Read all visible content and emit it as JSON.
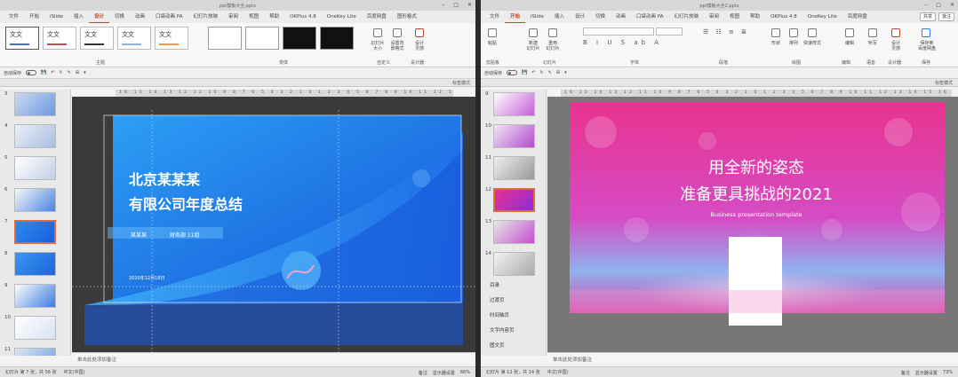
{
  "left": {
    "title": "ppt模板大全.pptx",
    "tabs": [
      "文件",
      "开始",
      "iSlide",
      "插入",
      "设计",
      "切换",
      "动画",
      "口袋动画 PA",
      "幻灯片放映",
      "审阅",
      "视图",
      "帮助",
      "OKPlus 4.8",
      "OneKey Lite",
      "百度网盘",
      "图形格式"
    ],
    "active_tab": "设计",
    "groups": {
      "theme": "主题",
      "variant": "变体",
      "customize": "自定义",
      "designer": "设计器"
    },
    "theme_text": "文文",
    "buttons": {
      "slide_size": "幻灯片\n大小",
      "bg_format": "设置背\n景格式",
      "design_ideas": "设计\n灵感"
    },
    "autosave": "自动保存",
    "label_mode": "标签模式",
    "ruler_marks": "16 15 14 13 12 11 10 9 8 7 6 5 4 3 2 1 0 1 2 3 4 5 6 7 8 9 10 11 12 13 14 15 16",
    "thumb_numbers": [
      "3",
      "4",
      "5",
      "6",
      "7",
      "8",
      "9",
      "10",
      "11"
    ],
    "selected_thumb": "7",
    "slide": {
      "title1": "北京某某某",
      "title2": "有限公司年度总结",
      "reporter": "某某某",
      "dept": "财务部 11组",
      "date": "2020年12月18日"
    },
    "notes": "单击此处添加备注",
    "status": {
      "slide": "幻灯片 第 7 张，共 56 张",
      "lang": "中文(中国)",
      "notes": "备注",
      "display": "显示器设置",
      "zoom": "66%"
    }
  },
  "right": {
    "title": "ppt模板大全2.pptx",
    "tabs": [
      "文件",
      "开始",
      "iSlide",
      "插入",
      "设计",
      "切换",
      "动画",
      "口袋动画 PA",
      "幻灯片放映",
      "审阅",
      "视图",
      "帮助",
      "OKPlus 4.8",
      "OneKey Lite",
      "百度网盘"
    ],
    "active_tab": "开始",
    "share": "共享",
    "comment": "批注",
    "groups": {
      "clipboard": "剪贴板",
      "slides": "幻灯片",
      "font": "字体",
      "paragraph": "段落",
      "drawing": "绘图",
      "edit": "编辑",
      "voice": "语音",
      "designer": "设计器",
      "save": "保存"
    },
    "buttons": {
      "paste": "粘贴",
      "new_slide": "新建\n幻灯片",
      "reuse": "重用\n幻灯片",
      "shape": "形状",
      "arrange": "排列",
      "quick_style": "快速样式",
      "edit": "编辑",
      "dictate": "听写",
      "design": "设计\n灵感",
      "save_baidu": "保存到\n百度网盘"
    },
    "autosave": "自动保存",
    "label_mode": "标签模式",
    "ruler_marks": "16 15 14 13 12 11 10 9 8 7 6 5 4 3 2 1 0 1 2 3 4 5 6 7 8 9 10 11 12 13 14 15 16",
    "thumb_numbers": [
      "9",
      "10",
      "11",
      "12",
      "13",
      "14"
    ],
    "selected_thumb": "12",
    "outline": [
      "目录",
      "过渡页",
      "时间轴页",
      "文字内容页",
      "图文页"
    ],
    "slide": {
      "line1": "用全新的姿态",
      "line2": "准备更具挑战的2021",
      "sub": "Business presentation template"
    },
    "notes": "单击此处添加备注",
    "status": {
      "slide": "幻灯片 第 12 张，共 14 张",
      "lang": "中文(中国)",
      "notes": "备注",
      "display": "显示器设置",
      "zoom": "73%"
    }
  },
  "colors": {
    "accent": "#b7472a",
    "blue": "#1e6fe8",
    "pink": "#e8338f"
  }
}
